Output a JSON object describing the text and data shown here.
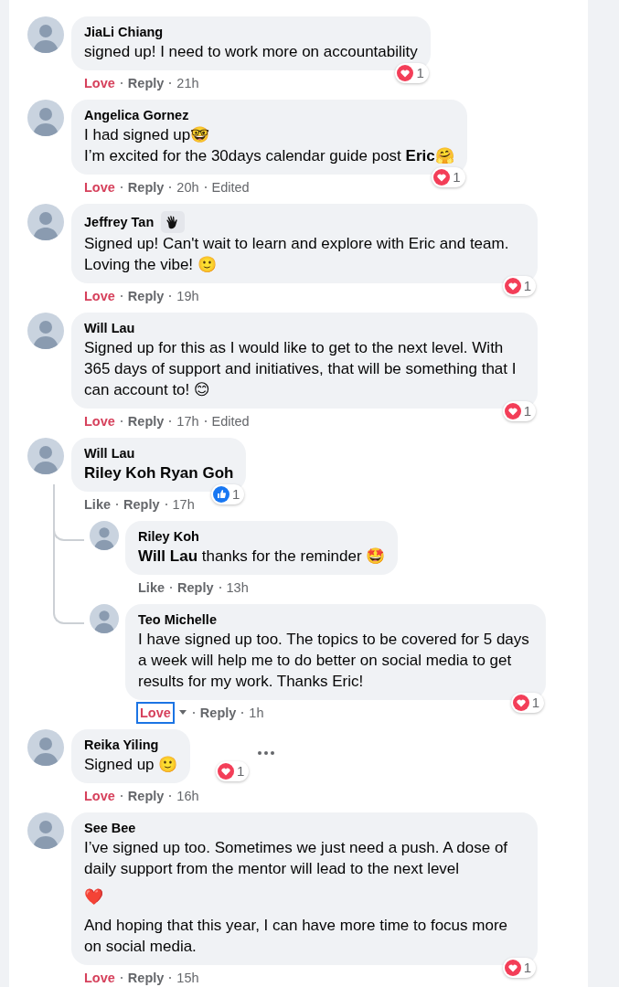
{
  "comments": [
    {
      "author": "JiaLi Chiang",
      "body": [
        "signed up! I need to work more on accountability"
      ],
      "reaction": {
        "kind": "love",
        "count": "1"
      },
      "actions": [
        {
          "label": "Love",
          "kind": "react",
          "reacted": true
        },
        {
          "label": "Reply",
          "kind": "reply"
        }
      ],
      "time": "21h"
    },
    {
      "author": "Angelica Gornez",
      "body": [
        "I had signed up🤓",
        "I’m excited for the 30days calendar guide post **Eric**🤗"
      ],
      "reaction": {
        "kind": "love",
        "count": "1"
      },
      "actions": [
        {
          "label": "Love",
          "kind": "react",
          "reacted": true
        },
        {
          "label": "Reply",
          "kind": "reply"
        }
      ],
      "time": "20h",
      "edited": "Edited"
    },
    {
      "author": "Jeffrey Tan",
      "has_badge": true,
      "body": [
        "Signed up! Can't wait to learn and explore with Eric and team. Loving the vibe! 🙂"
      ],
      "reaction": {
        "kind": "love",
        "count": "1"
      },
      "actions": [
        {
          "label": "Love",
          "kind": "react",
          "reacted": true
        },
        {
          "label": "Reply",
          "kind": "reply"
        }
      ],
      "time": "19h"
    },
    {
      "author": "Will Lau",
      "body": [
        "Signed up for this as I would like to get to the next level. With 365 days of support and initiatives, that will be something that I can account to! 😊"
      ],
      "reaction": {
        "kind": "love",
        "count": "1"
      },
      "actions": [
        {
          "label": "Love",
          "kind": "react",
          "reacted": true
        },
        {
          "label": "Reply",
          "kind": "reply"
        }
      ],
      "time": "17h",
      "edited": "Edited"
    },
    {
      "author": "Will Lau",
      "body": [
        "Riley Koh Ryan Goh"
      ],
      "body_bold": true,
      "reaction": {
        "kind": "like",
        "count": "1"
      },
      "actions": [
        {
          "label": "Like",
          "kind": "react",
          "reacted": false
        },
        {
          "label": "Reply",
          "kind": "reply"
        }
      ],
      "time": "17h",
      "children": [
        {
          "author": "Riley Koh",
          "body": [
            "**Will Lau** thanks for the reminder 🤩"
          ],
          "actions": [
            {
              "label": "Like",
              "kind": "react",
              "reacted": false
            },
            {
              "label": "Reply",
              "kind": "reply"
            }
          ],
          "time": "13h"
        },
        {
          "author": "Teo Michelle",
          "body": [
            "I have signed up too. The topics to be covered for 5 days a week will help me to do better on social media to get results for my work. Thanks Eric!"
          ],
          "reaction": {
            "kind": "love",
            "count": "1"
          },
          "actions": [
            {
              "label": "Love",
              "kind": "react",
              "reacted": true,
              "focused": true
            },
            {
              "label": "Reply",
              "kind": "reply"
            }
          ],
          "time": "1h"
        }
      ]
    },
    {
      "author": "Reika Yiling",
      "body": [
        "Signed up 🙂"
      ],
      "reaction": {
        "kind": "love",
        "count": "1"
      },
      "reaction_beside": true,
      "more_menu": true,
      "actions": [
        {
          "label": "Love",
          "kind": "react",
          "reacted": true
        },
        {
          "label": "Reply",
          "kind": "reply"
        }
      ],
      "time": "16h"
    },
    {
      "author": "See Bee",
      "body": [
        "I’ve signed up too. Sometimes we just need a push. A dose of daily support from the mentor will lead to the next level",
        "❤️",
        "And hoping that this year, I can have more time to focus more on social media."
      ],
      "reaction": {
        "kind": "love",
        "count": "1"
      },
      "actions": [
        {
          "label": "Love",
          "kind": "react",
          "reacted": true
        },
        {
          "label": "Reply",
          "kind": "reply"
        }
      ],
      "time": "15h"
    }
  ]
}
